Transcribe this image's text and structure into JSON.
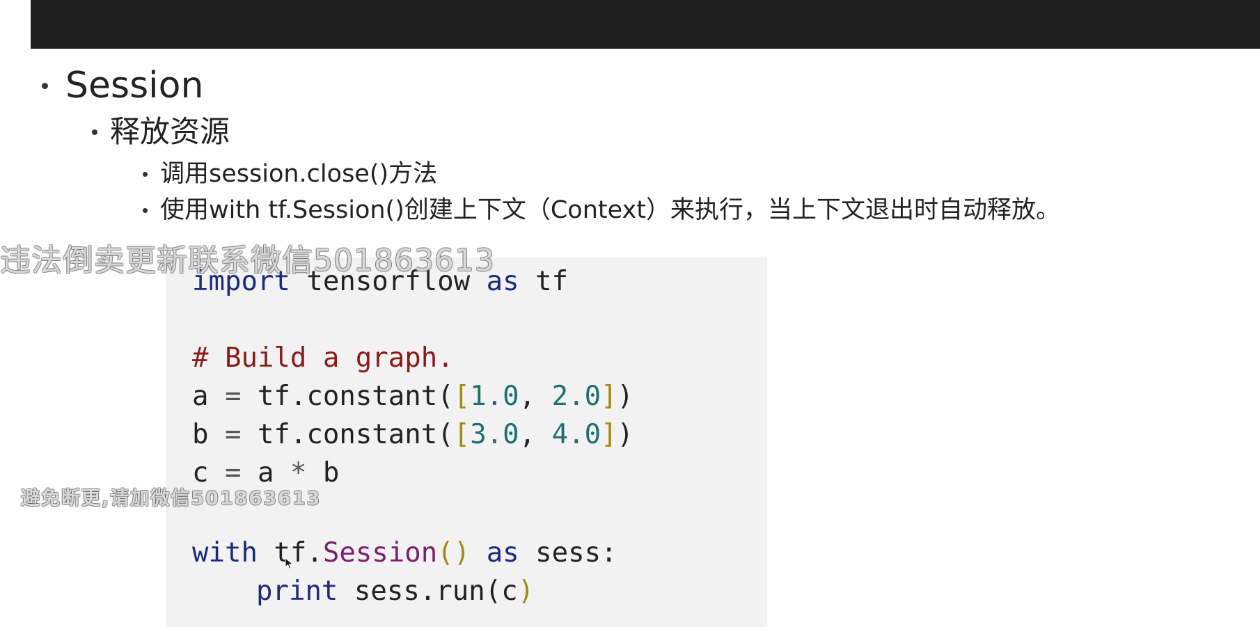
{
  "slide": {
    "heading": "Session",
    "subheading": "释放资源",
    "points": [
      "调用session.close()方法",
      "使用with tf.Session()创建上下文（Context）来执行，当上下文退出时自动释放。"
    ]
  },
  "code": {
    "l1_kw1": "import",
    "l1_mod": "tensorflow",
    "l1_kw2": "as",
    "l1_alias": "tf",
    "l2_comment": "# Build a graph.",
    "l3_lhs": "a",
    "l3_eq": "=",
    "l3_call": "tf.constant(",
    "l3_open": "[",
    "l3_n1": "1.0",
    "l3_sep": ",",
    "l3_n2": "2.0",
    "l3_close": "]",
    "l3_paren": ")",
    "l4_lhs": "b",
    "l4_eq": "=",
    "l4_call": "tf.constant(",
    "l4_open": "[",
    "l4_n1": "3.0",
    "l4_sep": ",",
    "l4_n2": "4.0",
    "l4_close": "]",
    "l4_paren": ")",
    "l5_lhs": "c",
    "l5_eq": "=",
    "l5_a": "a",
    "l5_op": "*",
    "l5_b": "b",
    "l6_kw1": "with",
    "l6_mod": "tf.",
    "l6_cls": "Session",
    "l6_parens": "()",
    "l6_kw2": "as",
    "l6_var": "sess:",
    "l7_kw": "print",
    "l7_call": "sess.run(",
    "l7_arg": "c",
    "l7_paren": ")"
  },
  "watermarks": {
    "top": "违法倒卖更新联系微信501863613",
    "middle": "避免断更,请加微信501863613"
  },
  "colors": {
    "top_bar": "#1f1f1f",
    "code_background": "#f2f2f2",
    "keyword": "#1c2a7a",
    "comment": "#8b1a1a",
    "number": "#1f6f6f",
    "bracket": "#a38a12",
    "class_name": "#7a1e6e"
  },
  "icons": {
    "cursor": "mouse-pointer-icon"
  }
}
